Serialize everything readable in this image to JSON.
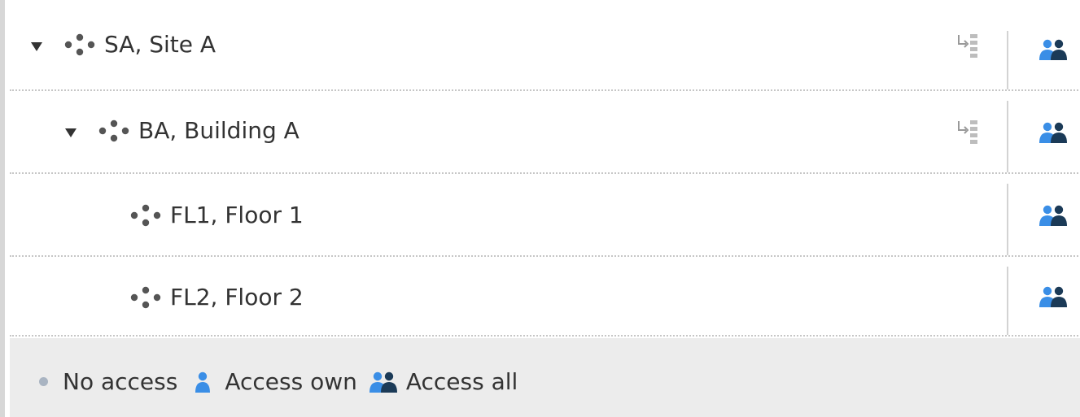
{
  "tree": {
    "rows": [
      {
        "label": "SA, Site A",
        "expanded": true,
        "level": 0,
        "has_tool": true,
        "access": "access-all"
      },
      {
        "label": "BA, Building A",
        "expanded": true,
        "level": 1,
        "has_tool": true,
        "access": "access-all"
      },
      {
        "label": "FL1, Floor 1",
        "expanded": false,
        "level": 2,
        "has_tool": false,
        "access": "access-all"
      },
      {
        "label": "FL2, Floor 2",
        "expanded": false,
        "level": 2,
        "has_tool": false,
        "access": "access-all"
      }
    ]
  },
  "legend": {
    "no_access": "No access",
    "access_own": "Access own",
    "access_all": "Access all"
  },
  "colors": {
    "access_light": "#3a8ee6",
    "access_dark": "#1b3a57",
    "no_access_dot": "#a9b4c2",
    "node_icon": "#555555",
    "tool_icon": "#a8a8a8"
  },
  "icons": {
    "node": "location-node-icon",
    "tree_tool": "apply-to-children-icon",
    "access_all": "access-all-icon",
    "access_own": "access-own-icon",
    "no_access": "no-access-dot-icon"
  }
}
